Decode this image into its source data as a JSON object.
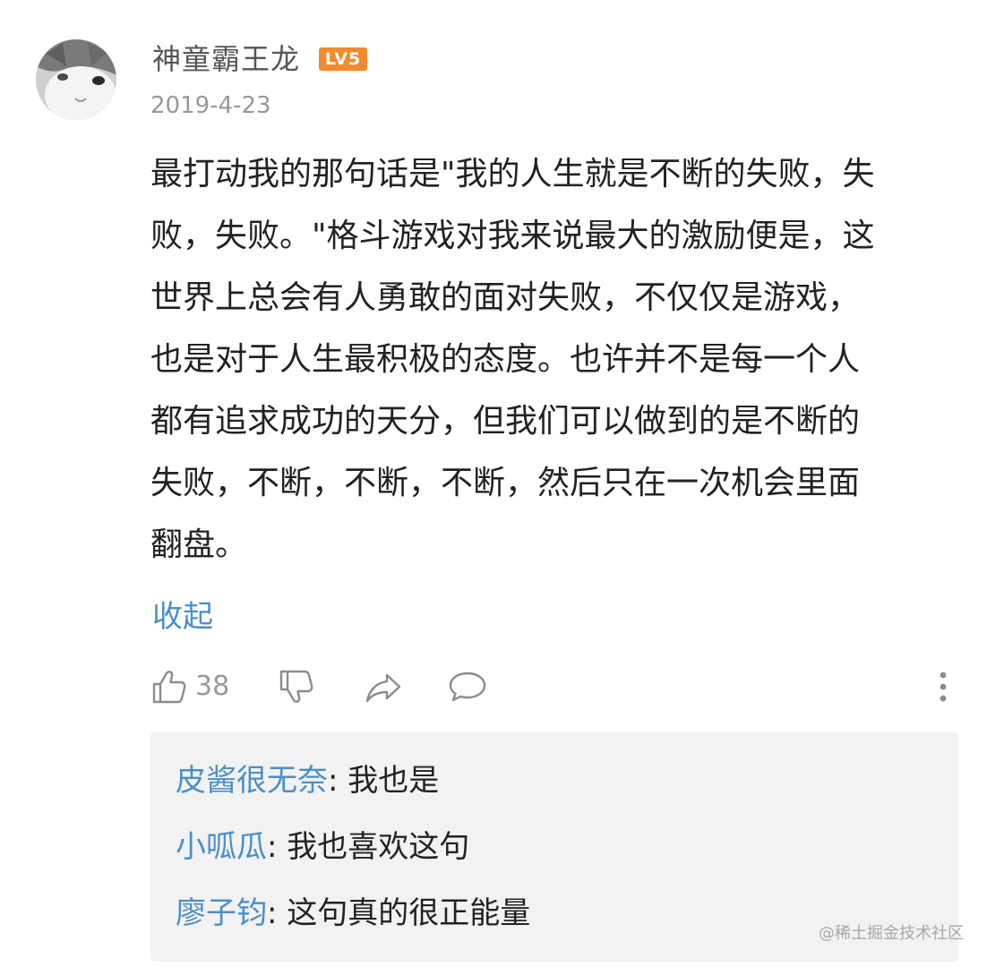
{
  "comment": {
    "avatar": "cat-avatar",
    "username": "神童霸王龙",
    "level_badge": "LV5",
    "date": "2019-4-23",
    "body": "最打动我的那句话是\"我的人生就是不断的失败，失\n败，失败。\"格斗游戏对我来说最大的激励便是，这\n世界上总会有人勇敢的面对失败，不仅仅是游戏，\n也是对于人生最积极的态度。也许并不是每一个人\n都有追求成功的天分，但我们可以做到的是不断的\n失败，不断，不断，不断，然后只在一次机会里面\n翻盘。",
    "collapse_label": "收起",
    "likes": "38"
  },
  "actions": {
    "like_icon": "thumbs-up-icon",
    "dislike_icon": "thumbs-down-icon",
    "share_icon": "share-arrow-icon",
    "reply_icon": "speech-bubble-icon",
    "more_icon": "vertical-dots-icon"
  },
  "replies": [
    {
      "author": "皮酱很无奈",
      "separator": ": ",
      "text": "我也是"
    },
    {
      "author": "小呱瓜",
      "separator": ": ",
      "text": "我也喜欢这句"
    },
    {
      "author": "廖子钧",
      "separator": ": ",
      "text": "这句真的很正能量"
    }
  ],
  "watermark": "@稀土掘金技术社区",
  "colors": {
    "link_blue": "#4a8fc7",
    "badge_orange": "#f28a2e",
    "muted_gray": "#999999",
    "reply_bg": "#f2f2f2"
  }
}
